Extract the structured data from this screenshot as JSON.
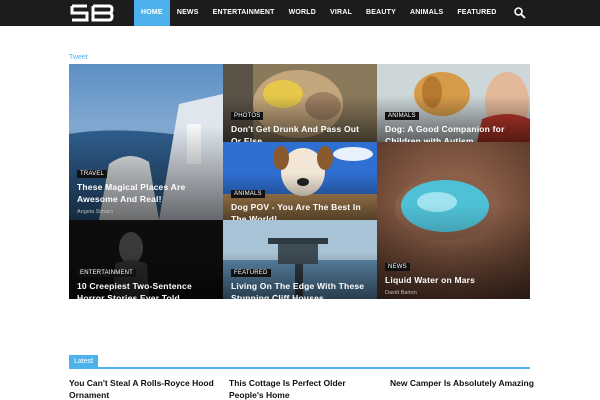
{
  "logo_text": "SB",
  "nav": {
    "items": [
      "HOME",
      "NEWS",
      "ENTERTAINMENT",
      "WORLD",
      "VIRAL",
      "BEAUTY",
      "ANIMALS",
      "FEATURED"
    ]
  },
  "tweet_label": "Tweet",
  "tiles": {
    "t1": {
      "category": "TRAVEL",
      "title": "These Magical Places Are Awesome And Real!",
      "author": "Angela Simaro"
    },
    "t2": {
      "category": "PHOTOS",
      "title": "Don't Get Drunk And Pass Out Or Else..."
    },
    "t3": {
      "category": "ANIMALS",
      "title": "Dog: A Good Companion for Children with Autism"
    },
    "t4": {
      "category": "ANIMALS",
      "title": "Dog POV - You Are The Best In The World!"
    },
    "t5": {
      "category": "NEWS",
      "title": "Liquid Water on Mars",
      "author": "David Barton"
    },
    "t6": {
      "category": "ENTERTAINMENT",
      "title": "10 Creepiest Two-Sentence Horror Stories Ever Told"
    },
    "t7": {
      "category": "FEATURED",
      "title": "Living On The Edge With These Stunning Cliff Houses"
    }
  },
  "latest": {
    "label": "Latest",
    "items": [
      "You Can't Steal A Rolls-Royce Hood Ornament",
      "This Cottage Is Perfect Older People's Home",
      "New Camper Is Absolutely Amazing"
    ]
  },
  "colors": {
    "accent": "#4db2ec",
    "topbar": "#1c1c1c"
  }
}
